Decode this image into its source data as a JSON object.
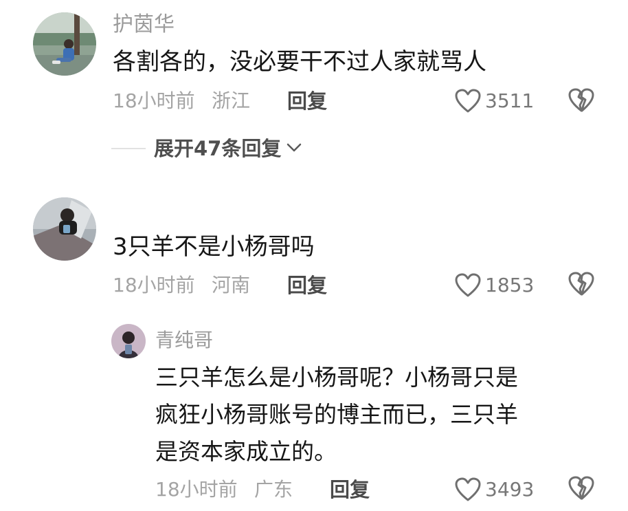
{
  "comments": [
    {
      "username": "护茵华",
      "text": "各割各的，没必要干不过人家就骂人",
      "time": "18小时前",
      "location": "浙江",
      "reply_label": "回复",
      "likes": "3511",
      "expand_replies": "展开47条回复"
    },
    {
      "username": "",
      "text": "3只羊不是小杨哥吗",
      "time": "18小时前",
      "location": "河南",
      "reply_label": "回复",
      "likes": "1853",
      "reply": {
        "username": "青纯哥",
        "lines": [
          "三只羊怎么是小杨哥呢？小杨哥只是",
          "疯狂小杨哥账号的博主而已，三只羊",
          "是资本家成立的。"
        ],
        "time": "18小时前",
        "location": "广东",
        "reply_label": "回复",
        "likes": "3493"
      }
    }
  ],
  "icons": {
    "like": "heart-outline-icon",
    "dislike": "broken-heart-icon",
    "expand": "chevron-down-icon"
  },
  "colors": {
    "username": "#9b9b9b",
    "meta": "#a4a4a4",
    "text": "#161616",
    "icon": "#6f6f6f"
  }
}
